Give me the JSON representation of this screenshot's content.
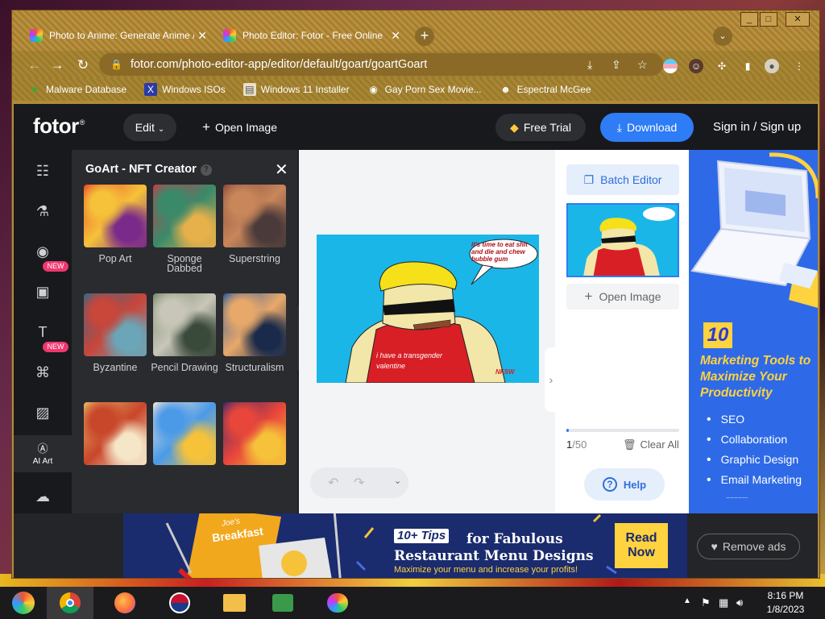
{
  "browser": {
    "tabs": [
      {
        "title": "Photo to Anime: Generate Anime /",
        "active": false
      },
      {
        "title": "Photo Editor: Fotor - Free Online",
        "active": true
      }
    ],
    "url": "fotor.com/photo-editor-app/editor/default/goart/goartGoart",
    "bookmarks": [
      {
        "label": "Malware Database",
        "icon": "bookmark-icon"
      },
      {
        "label": "Windows ISOs",
        "icon": "x-logo-icon"
      },
      {
        "label": "Windows 11 Installer",
        "icon": "folder-icon"
      },
      {
        "label": "Gay Porn Sex Movie...",
        "icon": "site-icon"
      },
      {
        "label": "Espectral McGee",
        "icon": "avatar-icon"
      }
    ]
  },
  "header": {
    "logo": "fotor",
    "logo_mark": "®",
    "edit": "Edit",
    "open_image": "Open Image",
    "free_trial": "Free Trial",
    "download": "Download",
    "sign_in": "Sign in / Sign up"
  },
  "rail": {
    "items": [
      {
        "icon": "adjust-sliders-icon"
      },
      {
        "icon": "beaker-icon"
      },
      {
        "icon": "eye-icon"
      },
      {
        "icon": "frame-icon",
        "badge": "NEW"
      },
      {
        "icon": "text-icon"
      },
      {
        "icon": "elements-icon",
        "badge": "NEW"
      },
      {
        "icon": "image-icon"
      },
      {
        "icon": "ai-art-icon",
        "label": "AI Art",
        "active": true
      },
      {
        "icon": "upload-cloud-icon"
      }
    ]
  },
  "panel": {
    "title": "GoArt - NFT Creator",
    "styles": [
      {
        "label": "Pop Art",
        "colors": [
          "#e84a2a",
          "#f6c23a",
          "#7a2a8a"
        ]
      },
      {
        "label": "Sponge Dabbed",
        "colors": [
          "#c83a4a",
          "#3a8a6a",
          "#e6b04a"
        ]
      },
      {
        "label": "Superstring",
        "colors": [
          "#8a4a3a",
          "#c8865a",
          "#4a3a3a"
        ]
      },
      {
        "label": "Byzantine",
        "colors": [
          "#2a6a8a",
          "#c8463a",
          "#6aa6b8"
        ]
      },
      {
        "label": "Pencil Drawing",
        "colors": [
          "#7a8a6a",
          "#c8c6b8",
          "#3a4a3a"
        ]
      },
      {
        "label": "Structuralism",
        "colors": [
          "#2a5a9a",
          "#e8a86a",
          "#1a2a4a"
        ]
      },
      {
        "label": "",
        "colors": [
          "#e8b86a",
          "#c8462a",
          "#f6e6c8"
        ]
      },
      {
        "label": "",
        "colors": [
          "#f6e6d8",
          "#4a9ae8",
          "#f6c23a"
        ]
      },
      {
        "label": "",
        "colors": [
          "#3a2a6a",
          "#e8463a",
          "#f6c23a"
        ]
      }
    ]
  },
  "canvas": {
    "speech_bubble": "it's time to eat shit and die and chew bubble gum",
    "shirt_text": "i have a transgender valentine",
    "signature": "NFSW"
  },
  "right_panel": {
    "batch_editor": "Batch Editor",
    "open_image": "Open Image",
    "count_current": "1",
    "count_total": "/50",
    "clear_all": "Clear All",
    "help": "Help"
  },
  "side_ad": {
    "number": "10",
    "headline": "Marketing Tools to Maximize Your Productivity",
    "items": [
      "SEO",
      "Collaboration",
      "Graphic Design",
      "Email Marketing"
    ],
    "more": "..........."
  },
  "bottom_ad": {
    "badge": "10+ Tips",
    "headline_1": "for Fabulous",
    "headline_2": "Restaurant Menu Designs",
    "sub": "Maximize your menu and increase your profits!",
    "cta": "Read Now",
    "menu_script": "Joe's",
    "menu_title": "Breakfast",
    "remove_ads": "Remove ads"
  },
  "taskbar": {
    "time": "8:16 PM",
    "date": "1/8/2023",
    "apps": [
      "start-icon",
      "chrome-icon",
      "firefox-icon",
      "brand-icon",
      "file-explorer-icon",
      "network-icon",
      "paint-icon"
    ]
  },
  "colors": {
    "accent": "#2e7cf6",
    "badge_new": "#f0376f",
    "ad_yellow": "#ffd23f"
  }
}
